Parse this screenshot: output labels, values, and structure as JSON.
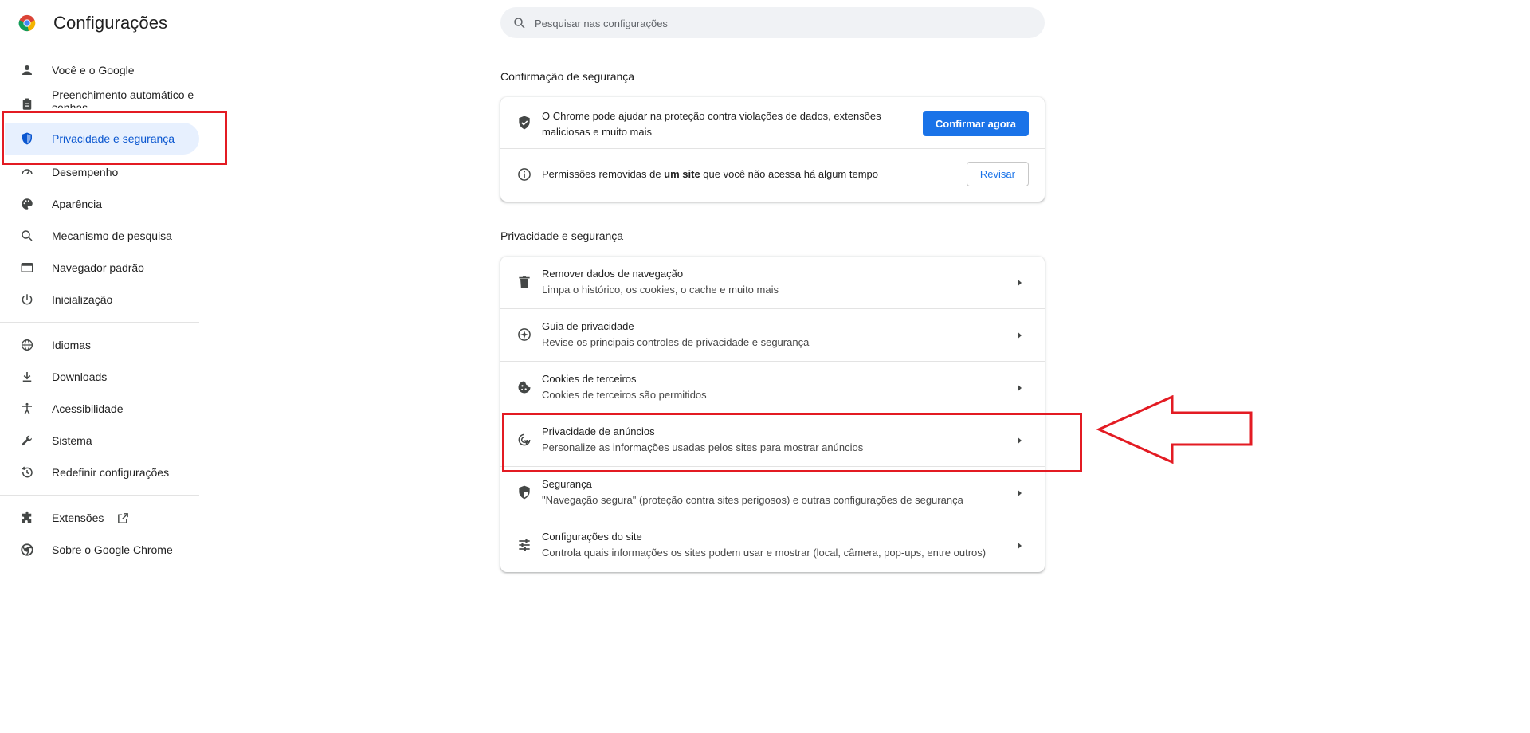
{
  "header": {
    "title": "Configurações",
    "search_placeholder": "Pesquisar nas configurações"
  },
  "sidebar": {
    "items": [
      {
        "label": "Você e o Google",
        "icon": "person-icon"
      },
      {
        "label": "Preenchimento automático e senhas",
        "icon": "clipboard-icon"
      },
      {
        "label": "Privacidade e segurança",
        "icon": "shield-icon",
        "active": true
      },
      {
        "label": "Desempenho",
        "icon": "speedometer-icon"
      },
      {
        "label": "Aparência",
        "icon": "palette-icon"
      },
      {
        "label": "Mecanismo de pesquisa",
        "icon": "search-icon"
      },
      {
        "label": "Navegador padrão",
        "icon": "browser-icon"
      },
      {
        "label": "Inicialização",
        "icon": "power-icon"
      },
      {
        "label": "Idiomas",
        "icon": "globe-icon"
      },
      {
        "label": "Downloads",
        "icon": "download-icon"
      },
      {
        "label": "Acessibilidade",
        "icon": "accessibility-icon"
      },
      {
        "label": "Sistema",
        "icon": "wrench-icon"
      },
      {
        "label": "Redefinir configurações",
        "icon": "history-icon"
      },
      {
        "label": "Extensões",
        "icon": "puzzle-icon"
      },
      {
        "label": "Sobre o Google Chrome",
        "icon": "chrome-icon"
      }
    ]
  },
  "safety_check": {
    "title": "Confirmação de segurança",
    "row1_text": "O Chrome pode ajudar na proteção contra violações de dados, extensões maliciosas e muito mais",
    "row1_button": "Confirmar agora",
    "row2_prefix": "Permissões removidas de ",
    "row2_bold": "um site",
    "row2_suffix": " que você não acessa há algum tempo",
    "row2_button": "Revisar"
  },
  "privacy": {
    "title": "Privacidade e segurança",
    "rows": [
      {
        "title": "Remover dados de navegação",
        "sub": "Limpa o histórico, os cookies, o cache e muito mais",
        "icon": "trash-icon"
      },
      {
        "title": "Guia de privacidade",
        "sub": "Revise os principais controles de privacidade e segurança",
        "icon": "compass-icon"
      },
      {
        "title": "Cookies de terceiros",
        "sub": "Cookies de terceiros são permitidos",
        "icon": "cookie-icon"
      },
      {
        "title": "Privacidade de anúncios",
        "sub": "Personalize as informações usadas pelos sites para mostrar anúncios",
        "icon": "ad-privacy-icon"
      },
      {
        "title": "Segurança",
        "sub": "\"Navegação segura\" (proteção contra sites perigosos) e outras configurações de segurança",
        "icon": "security-shield-icon"
      },
      {
        "title": "Configurações do site",
        "sub": "Controla quais informações os sites podem usar e mostrar (local, câmera, pop-ups, entre outros)",
        "icon": "tune-icon"
      }
    ]
  },
  "colors": {
    "accent": "#1a73e8",
    "active_text": "#0b57d0",
    "annotation": "#e31b23"
  }
}
